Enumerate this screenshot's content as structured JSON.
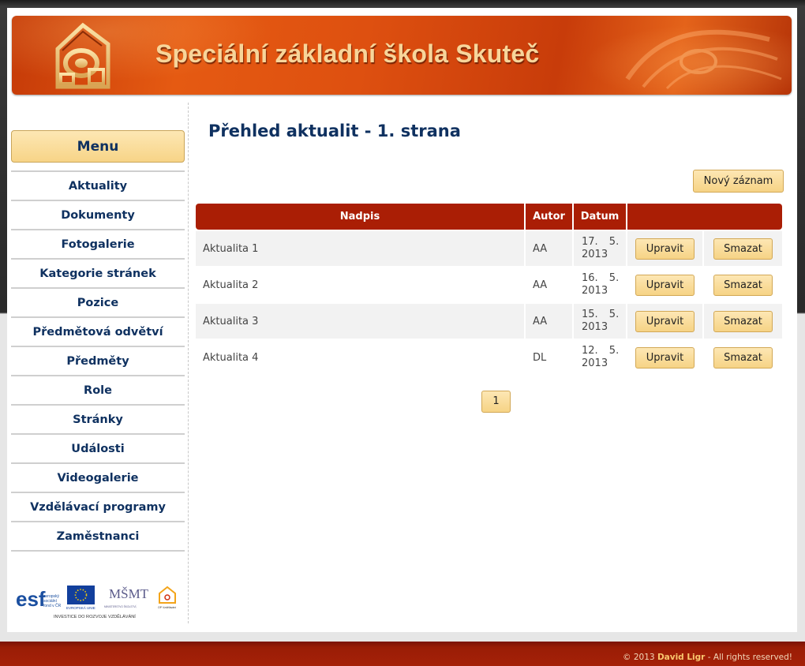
{
  "header": {
    "title": "Speciální základní škola Skuteč"
  },
  "menu": {
    "title": "Menu",
    "items": [
      {
        "label": "Aktuality"
      },
      {
        "label": "Dokumenty"
      },
      {
        "label": "Fotogalerie"
      },
      {
        "label": "Kategorie stránek"
      },
      {
        "label": "Pozice"
      },
      {
        "label": "Předmětová odvětví"
      },
      {
        "label": "Předměty"
      },
      {
        "label": "Role"
      },
      {
        "label": "Stránky"
      },
      {
        "label": "Události"
      },
      {
        "label": "Videogalerie"
      },
      {
        "label": "Vzdělávací programy"
      },
      {
        "label": "Zaměstnanci"
      }
    ]
  },
  "content": {
    "title": "Přehled aktualit - 1. strana",
    "new_button": "Nový záznam",
    "columns": [
      "Nadpis",
      "Autor",
      "Datum",
      ""
    ],
    "rows": [
      {
        "title": "Aktualita 1",
        "author": "AA",
        "date": "17. 5. 2013",
        "edit": "Upravit",
        "delete": "Smazat"
      },
      {
        "title": "Aktualita 2",
        "author": "AA",
        "date": "16. 5. 2013",
        "edit": "Upravit",
        "delete": "Smazat"
      },
      {
        "title": "Aktualita 3",
        "author": "AA",
        "date": "15. 5. 2013",
        "edit": "Upravit",
        "delete": "Smazat"
      },
      {
        "title": "Aktualita 4",
        "author": "DL",
        "date": "12. 5. 2013",
        "edit": "Upravit",
        "delete": "Smazat"
      }
    ],
    "pagination": {
      "current_page": "1"
    }
  },
  "logos": {
    "esf_text": "evropský sociální fond v ČR",
    "eu_text": "EVROPSKÁ UNIE",
    "msmt_text": "MINISTERSTVO ŠKOLSTVÍ, MLÁDEŽE A TĚLOVÝCHOVY",
    "op_text": "OP Vzdělávání pro konkurenceschopnost",
    "tagline": "INVESTICE DO ROZVOJE VZDĚLÁVÁNÍ"
  },
  "footer": {
    "prefix": "© 2013",
    "author": "David Ligr",
    "suffix": "- All rights reserved!"
  },
  "colors": {
    "header_red": "#aa1e05",
    "nav_text": "#0f3160",
    "button_gold": "#f6d385",
    "banner_orange": "#de5010"
  }
}
